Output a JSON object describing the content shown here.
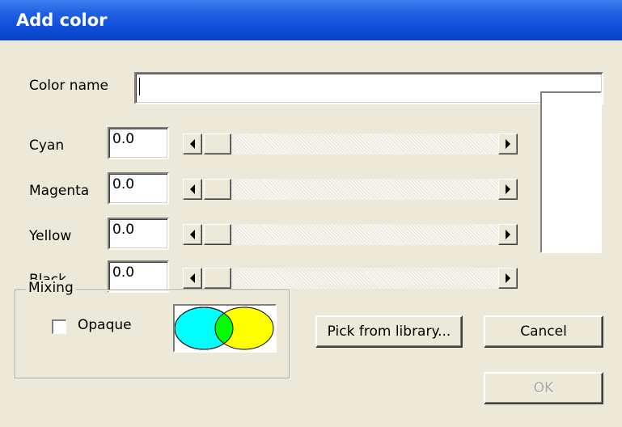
{
  "window": {
    "title": "Add color"
  },
  "color_name": {
    "label": "Color name",
    "value": ""
  },
  "channels": [
    {
      "label": "Cyan",
      "value": "0.0"
    },
    {
      "label": "Magenta",
      "value": "0.0"
    },
    {
      "label": "Yellow",
      "value": "0.0"
    },
    {
      "label": "Black",
      "value": "0.0"
    }
  ],
  "mixing": {
    "label": "Mixing",
    "opaque_label": "Opaque",
    "opaque_checked": false,
    "preview_colors": {
      "left": "#00ffff",
      "right": "#ffff00",
      "overlap": "#00ff00"
    }
  },
  "buttons": {
    "pick_library": "Pick from library...",
    "cancel": "Cancel",
    "ok": "OK"
  },
  "preview_swatch_color": "#ffffff"
}
